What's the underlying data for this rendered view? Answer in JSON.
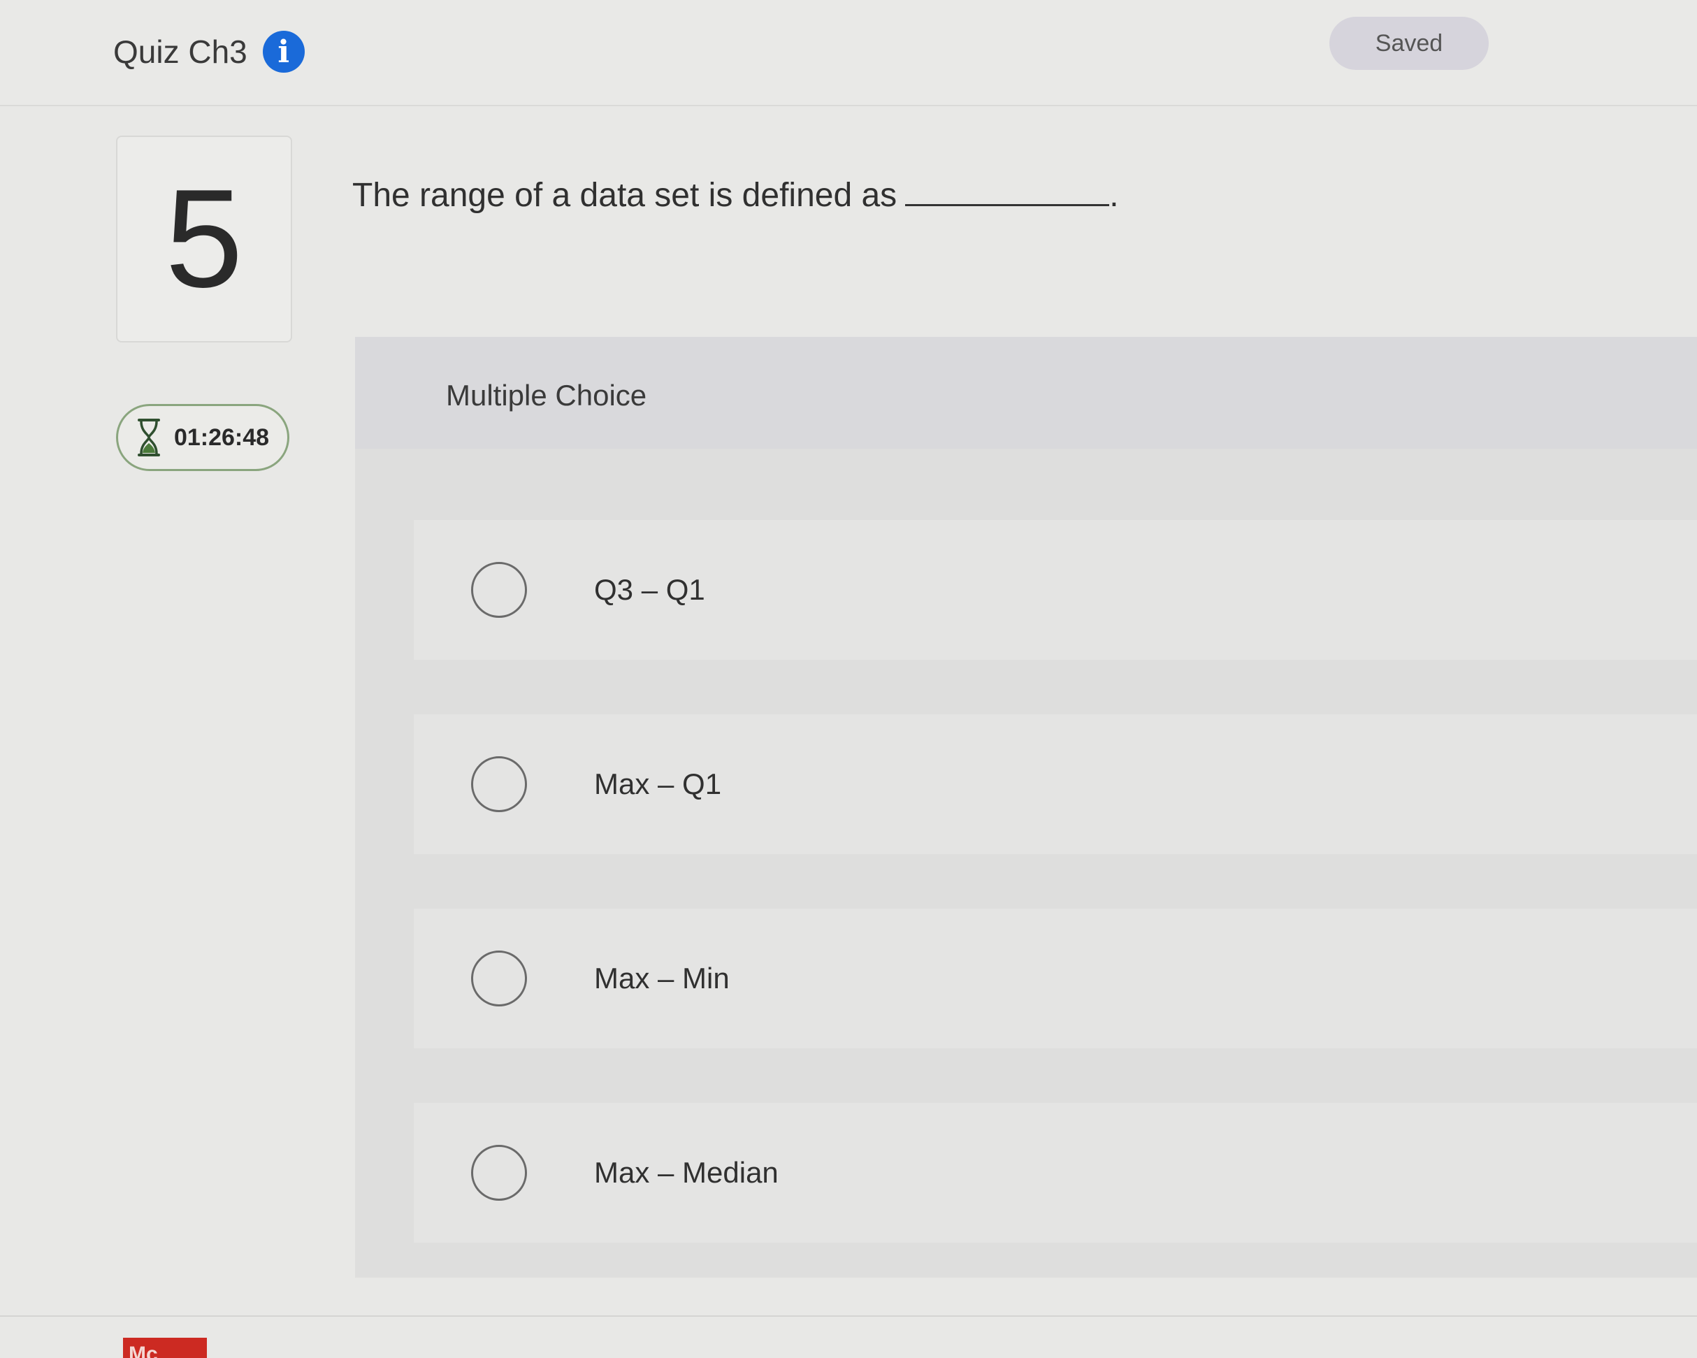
{
  "header": {
    "quiz_title": "Quiz Ch3",
    "info_icon": "info-icon",
    "status": "Saved"
  },
  "question": {
    "number": "5",
    "text": "The range of a data set is defined as",
    "end_punct": "."
  },
  "timer": {
    "icon": "hourglass-icon",
    "value": "01:26:48"
  },
  "answer_area": {
    "type_label": "Multiple Choice",
    "options": [
      {
        "label": "Q3 – Q1",
        "selected": false
      },
      {
        "label": "Max – Q1",
        "selected": false
      },
      {
        "label": "Max – Min",
        "selected": false
      },
      {
        "label": "Max – Median",
        "selected": false
      }
    ]
  },
  "footer": {
    "logo_text": "Mc"
  },
  "colors": {
    "info_blue": "#1a6ad9",
    "timer_border": "#8aa57e",
    "logo_red": "#cc2a22"
  }
}
